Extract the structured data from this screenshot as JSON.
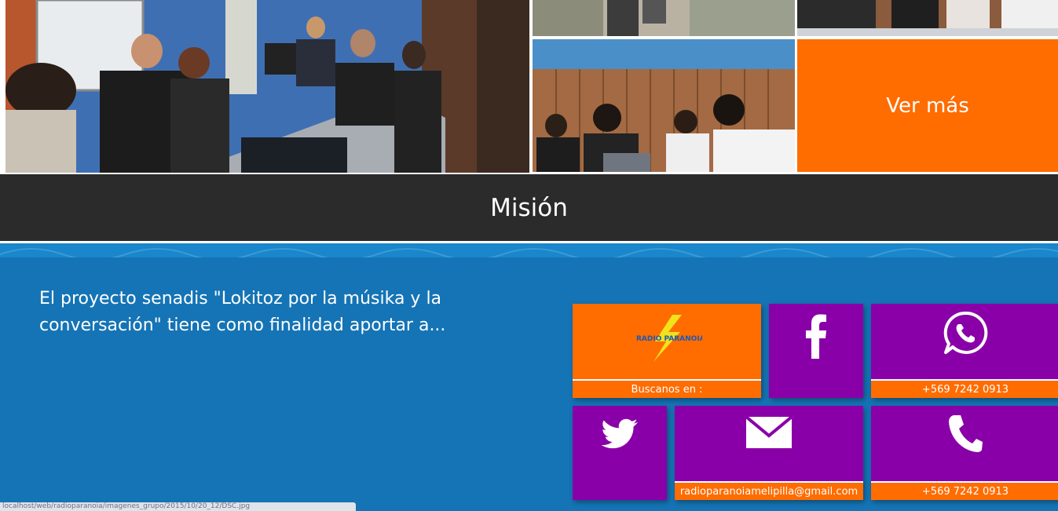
{
  "gallery": {
    "ver_mas_label": "Ver más"
  },
  "mission": {
    "heading": "Misión",
    "excerpt": "El proyecto senadis \"Lokitoz por la músika y la conversación\" tiene como finalidad aportar a..."
  },
  "contact": {
    "logo_text": "RADIO PARANOIA",
    "buscanos_label": "Buscanos en :",
    "whatsapp_number": "+569 7242 0913",
    "email": "radioparanoiamelipilla@gmail.com",
    "phone_number": "+569 7242 0913"
  },
  "icons": {
    "facebook": "facebook-icon",
    "whatsapp": "whatsapp-icon",
    "twitter": "twitter-icon",
    "email": "envelope-icon",
    "phone": "phone-icon"
  },
  "colors": {
    "orange": "#ff6c00",
    "purple": "#8a00a8",
    "dark_bar": "#2b2b2b",
    "blue_section": "#1574b5"
  },
  "status_bar": {
    "url": "localhost/web/radioparanoia/imagenes_grupo/2015/10/20_12/DSC.jpg"
  }
}
